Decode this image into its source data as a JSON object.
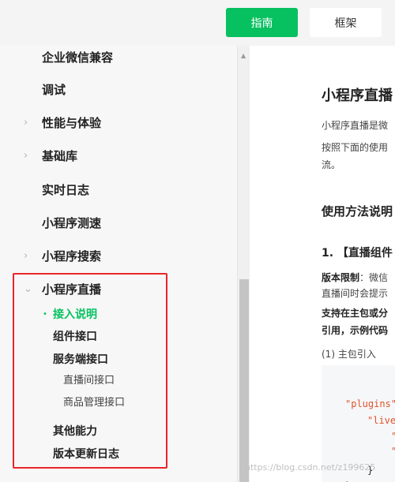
{
  "header": {
    "guide_label": "指南",
    "framework_label": "框架"
  },
  "sidebar": {
    "items": [
      {
        "label": "企业微信兼容",
        "arrow": ""
      },
      {
        "label": "调试",
        "arrow": ""
      },
      {
        "label": "性能与体验",
        "arrow": "›"
      },
      {
        "label": "基础库",
        "arrow": "›"
      },
      {
        "label": "实时日志",
        "arrow": ""
      },
      {
        "label": "小程序测速",
        "arrow": ""
      },
      {
        "label": "小程序搜索",
        "arrow": "›"
      },
      {
        "label": "小程序直播",
        "arrow": "⌄"
      }
    ],
    "live_children": [
      {
        "label": "接入说明",
        "bullet": "•"
      },
      {
        "label": "组件接口"
      },
      {
        "label": "服务端接口"
      },
      {
        "label": "直播间接口"
      },
      {
        "label": "商品管理接口"
      },
      {
        "label": "其他能力"
      },
      {
        "label": "版本更新日志"
      }
    ]
  },
  "content": {
    "title": "小程序直播",
    "intro1": "小程序直播是微",
    "intro2": "按照下面的使用",
    "intro3": "流。",
    "section_title": "使用方法说明",
    "step1_title": "1. 【直播组件",
    "limit_label": "版本限制",
    "limit_text": "：微信",
    "limit_text2": "直播间时会提示",
    "support1": "支持在主包或分",
    "support2": "引用，示例代码",
    "main_import": "(1) 主包引入",
    "code_line1": "\"plugins\"",
    "code_line2": "\"live",
    "code_line3": "\"",
    "code_line4": "\"",
    "code_line5": "}",
    "code_line6": "}"
  },
  "watermark": "https://blog.csdn.net/z199625"
}
